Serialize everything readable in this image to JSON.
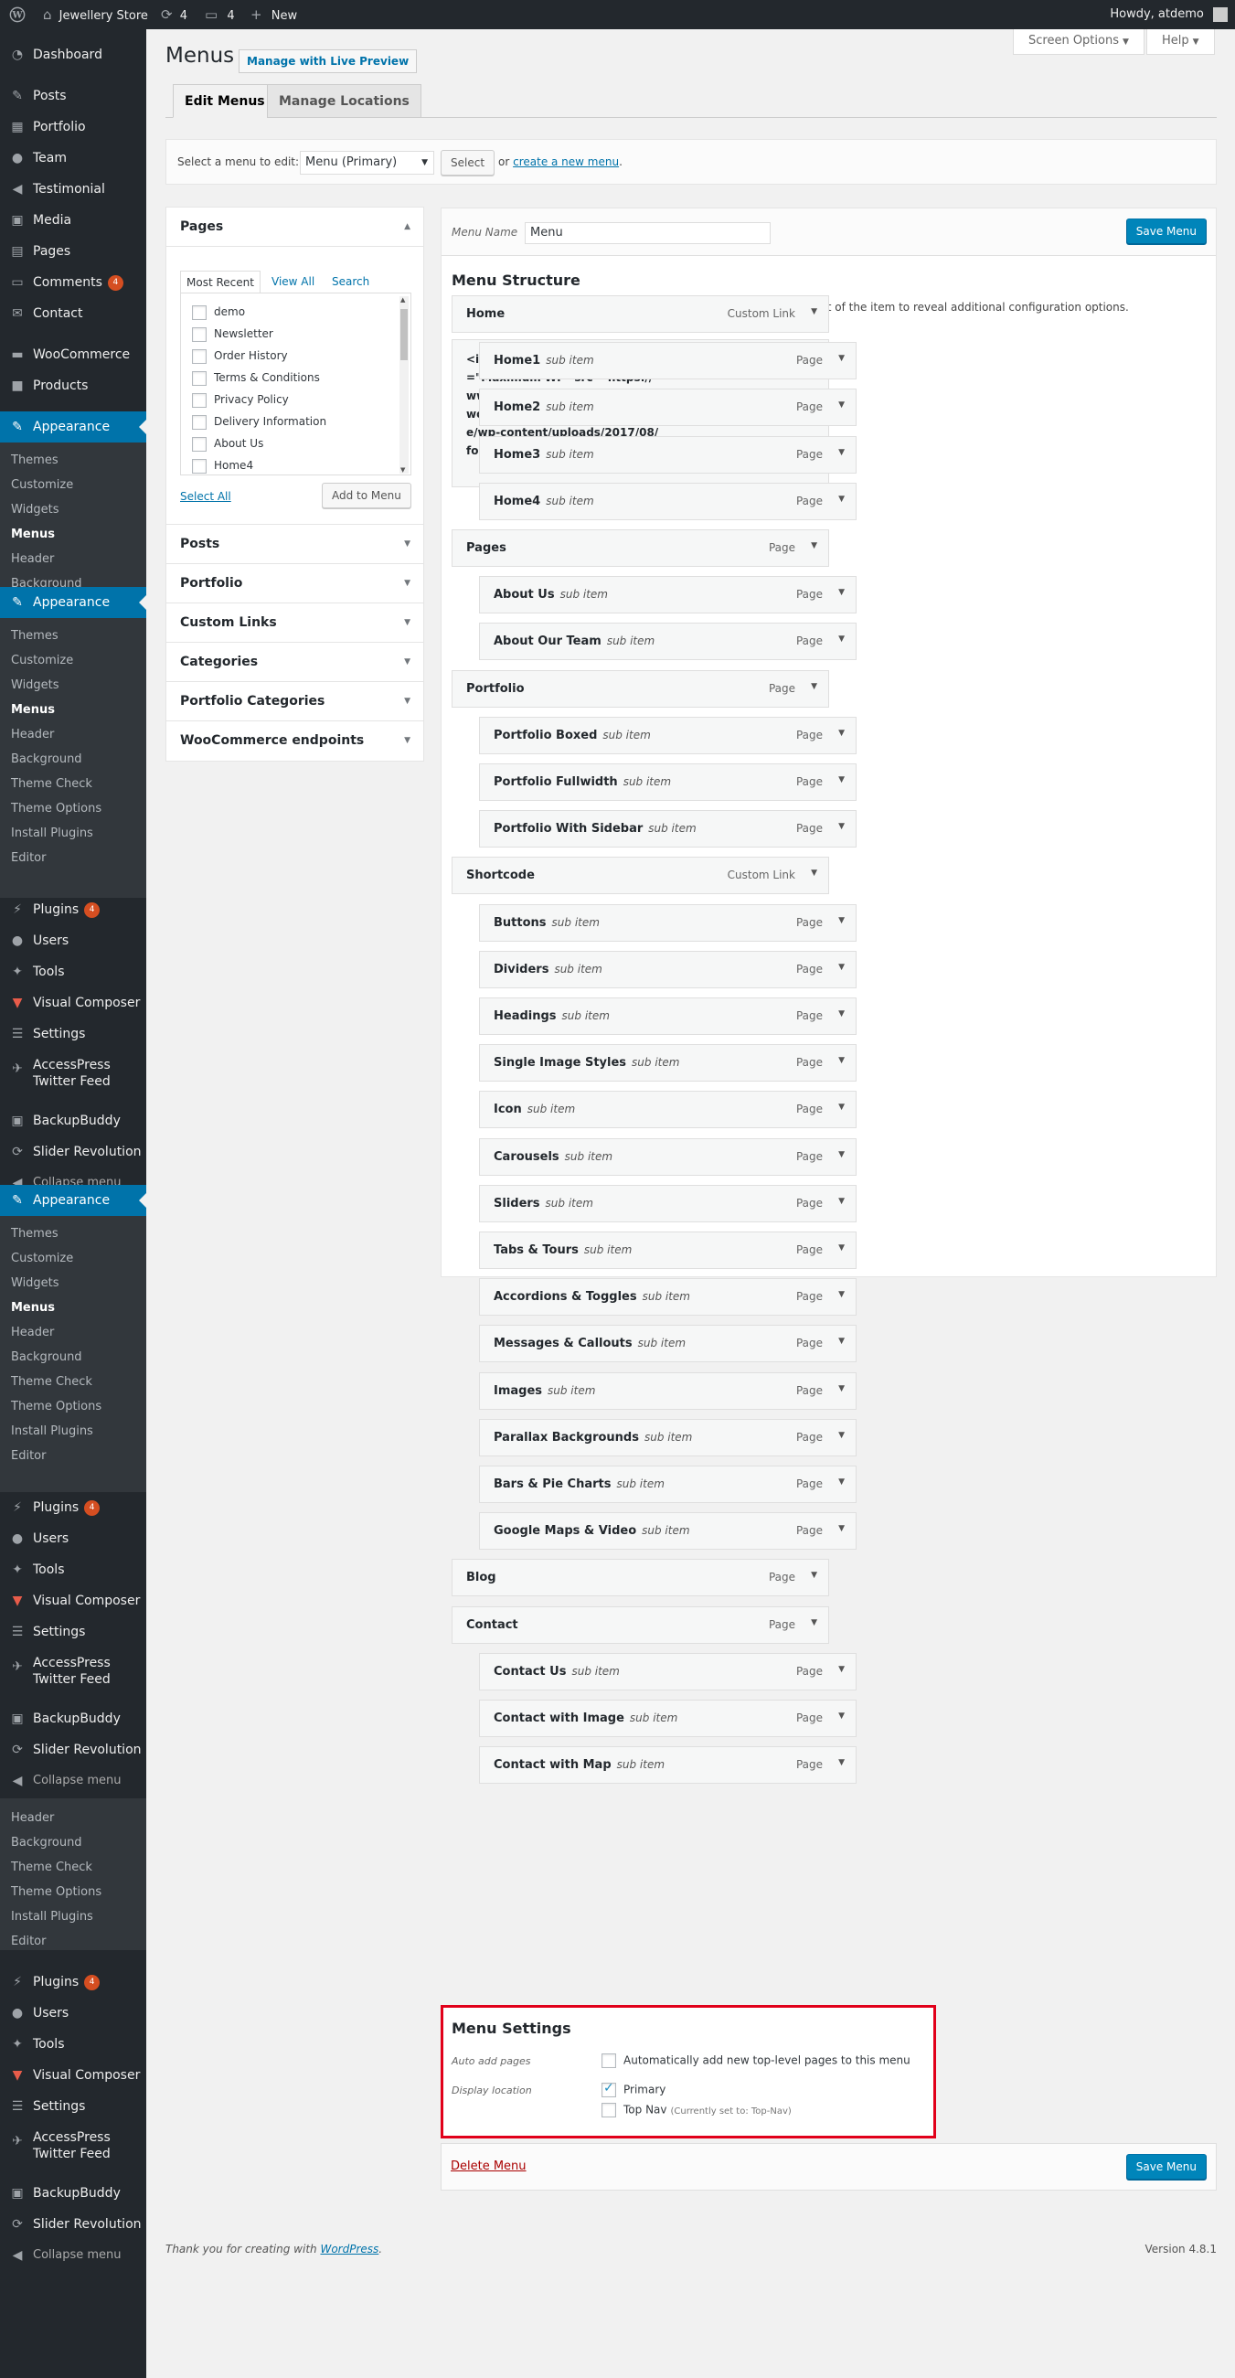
{
  "adminbar": {
    "site_name": "Jewellery Store",
    "updates_count": "4",
    "comments_count": "4",
    "new_label": "New",
    "howdy": "Howdy, atdemo"
  },
  "sidebar": {
    "dashboard": "Dashboard",
    "posts": "Posts",
    "portfolio": "Portfolio",
    "team": "Team",
    "testimonial": "Testimonial",
    "media": "Media",
    "pages": "Pages",
    "comments": "Comments",
    "comments_badge": "4",
    "contact": "Contact",
    "woocommerce": "WooCommerce",
    "products": "Products",
    "appearance": "Appearance",
    "themes": "Themes",
    "customize": "Customize",
    "widgets": "Widgets",
    "menus": "Menus",
    "header": "Header",
    "background": "Background",
    "theme_check": "Theme Check",
    "theme_options": "Theme Options",
    "install_plugins": "Install Plugins",
    "editor": "Editor",
    "plugins": "Plugins",
    "plugins_badge": "4",
    "users": "Users",
    "tools": "Tools",
    "visual_composer": "Visual Composer",
    "settings": "Settings",
    "accesspress_1": "AccessPress",
    "accesspress_2": "Twitter Feed",
    "backupbuddy": "BackupBuddy",
    "slider_revolution": "Slider Revolution",
    "collapse": "Collapse menu"
  },
  "header": {
    "title": "Menus",
    "live_preview": "Manage with Live Preview",
    "screen_options": "Screen Options",
    "help": "Help"
  },
  "tabs": {
    "edit_menus": "Edit Menus",
    "manage_locations": "Manage Locations"
  },
  "manage": {
    "label": "Select a menu to edit:",
    "selected_menu": "Menu (Primary)",
    "select_button": "Select",
    "or_text": "or",
    "create_link": "create a new menu",
    "period": "."
  },
  "accordion": {
    "pages_title": "Pages",
    "inner_tabs": [
      "Most Recent",
      "View All",
      "Search"
    ],
    "pages_list": [
      "demo",
      "Newsletter",
      "Order History",
      "Terms & Conditions",
      "Privacy Policy",
      "Delivery Information",
      "About Us",
      "Home4"
    ],
    "select_all": "Select All",
    "add_to_menu": "Add to Menu",
    "sections": [
      "Posts",
      "Portfolio",
      "Custom Links",
      "Categories",
      "Portfolio Categories",
      "WooCommerce endpoints"
    ]
  },
  "menu_edit": {
    "name_label": "Menu Name",
    "name_value": "Menu",
    "save": "Save Menu",
    "structure_title": "Menu Structure",
    "structure_desc": "Drag each item into the order you prefer. Click the arrow on the right of the item to reveal additional configuration options.",
    "sub_item": "sub item",
    "first_item_title": "<img class=\"mobilelogo\" alt=\"Maximum WP\" src=\"https://www.multipurposethemes.com/wordpressdemo/maximum/base/wp-content/uploads/2017/08/footer_logo.png\">",
    "first_item_type": "Custom Link",
    "items": [
      {
        "title": "Home",
        "type": "Custom Link",
        "depth": 0
      },
      {
        "title": "Home1",
        "type": "Page",
        "depth": 1
      },
      {
        "title": "Home2",
        "type": "Page",
        "depth": 1
      },
      {
        "title": "Home3",
        "type": "Page",
        "depth": 1
      },
      {
        "title": "Home4",
        "type": "Page",
        "depth": 1
      },
      {
        "title": "Pages",
        "type": "Page",
        "depth": 0
      },
      {
        "title": "About Us",
        "type": "Page",
        "depth": 1
      },
      {
        "title": "About Our Team",
        "type": "Page",
        "depth": 1
      },
      {
        "title": "Portfolio",
        "type": "Page",
        "depth": 0
      },
      {
        "title": "Portfolio Boxed",
        "type": "Page",
        "depth": 1
      },
      {
        "title": "Portfolio Fullwidth",
        "type": "Page",
        "depth": 1
      },
      {
        "title": "Portfolio With Sidebar",
        "type": "Page",
        "depth": 1
      },
      {
        "title": "Shortcode",
        "type": "Custom Link",
        "depth": 0
      },
      {
        "title": "Buttons",
        "type": "Page",
        "depth": 1
      },
      {
        "title": "Dividers",
        "type": "Page",
        "depth": 1
      },
      {
        "title": "Headings",
        "type": "Page",
        "depth": 1
      },
      {
        "title": "Single Image Styles",
        "type": "Page",
        "depth": 1
      },
      {
        "title": "Icon",
        "type": "Page",
        "depth": 1
      },
      {
        "title": "Carousels",
        "type": "Page",
        "depth": 1
      },
      {
        "title": "Sliders",
        "type": "Page",
        "depth": 1
      },
      {
        "title": "Tabs & Tours",
        "type": "Page",
        "depth": 1
      },
      {
        "title": "Accordions & Toggles",
        "type": "Page",
        "depth": 1
      },
      {
        "title": "Messages & Callouts",
        "type": "Page",
        "depth": 1
      },
      {
        "title": "Images",
        "type": "Page",
        "depth": 1
      },
      {
        "title": "Parallax Backgrounds",
        "type": "Page",
        "depth": 1
      },
      {
        "title": "Bars & Pie Charts",
        "type": "Page",
        "depth": 1
      },
      {
        "title": "Google Maps & Video",
        "type": "Page",
        "depth": 1
      },
      {
        "title": "Blog",
        "type": "Page",
        "depth": 0
      },
      {
        "title": "Contact",
        "type": "Page",
        "depth": 0
      },
      {
        "title": "Contact Us",
        "type": "Page",
        "depth": 1
      },
      {
        "title": "Contact with Image",
        "type": "Page",
        "depth": 1
      },
      {
        "title": "Contact with Map",
        "type": "Page",
        "depth": 1
      }
    ]
  },
  "settings": {
    "title": "Menu Settings",
    "auto_add_label": "Auto add pages",
    "auto_add_text": "Automatically add new top-level pages to this menu",
    "auto_add_checked": false,
    "display_label": "Display location",
    "primary": "Primary",
    "primary_checked": true,
    "top_nav": "Top Nav",
    "top_nav_note": "(Currently set to: Top-Nav)",
    "top_nav_checked": false
  },
  "footer": {
    "delete_menu": "Delete Menu",
    "thanks_prefix": "Thank you for creating with",
    "thanks_link": "WordPress",
    "thanks_suffix": ".",
    "version": "Version 4.8.1"
  },
  "colors": {
    "admin_dark": "#23282d",
    "submenu_bg": "#32373c",
    "active_blue": "#0073aa",
    "button_primary": "#0085ba",
    "highlight_red": "#e1001a",
    "badge_orange": "#d54e21"
  }
}
